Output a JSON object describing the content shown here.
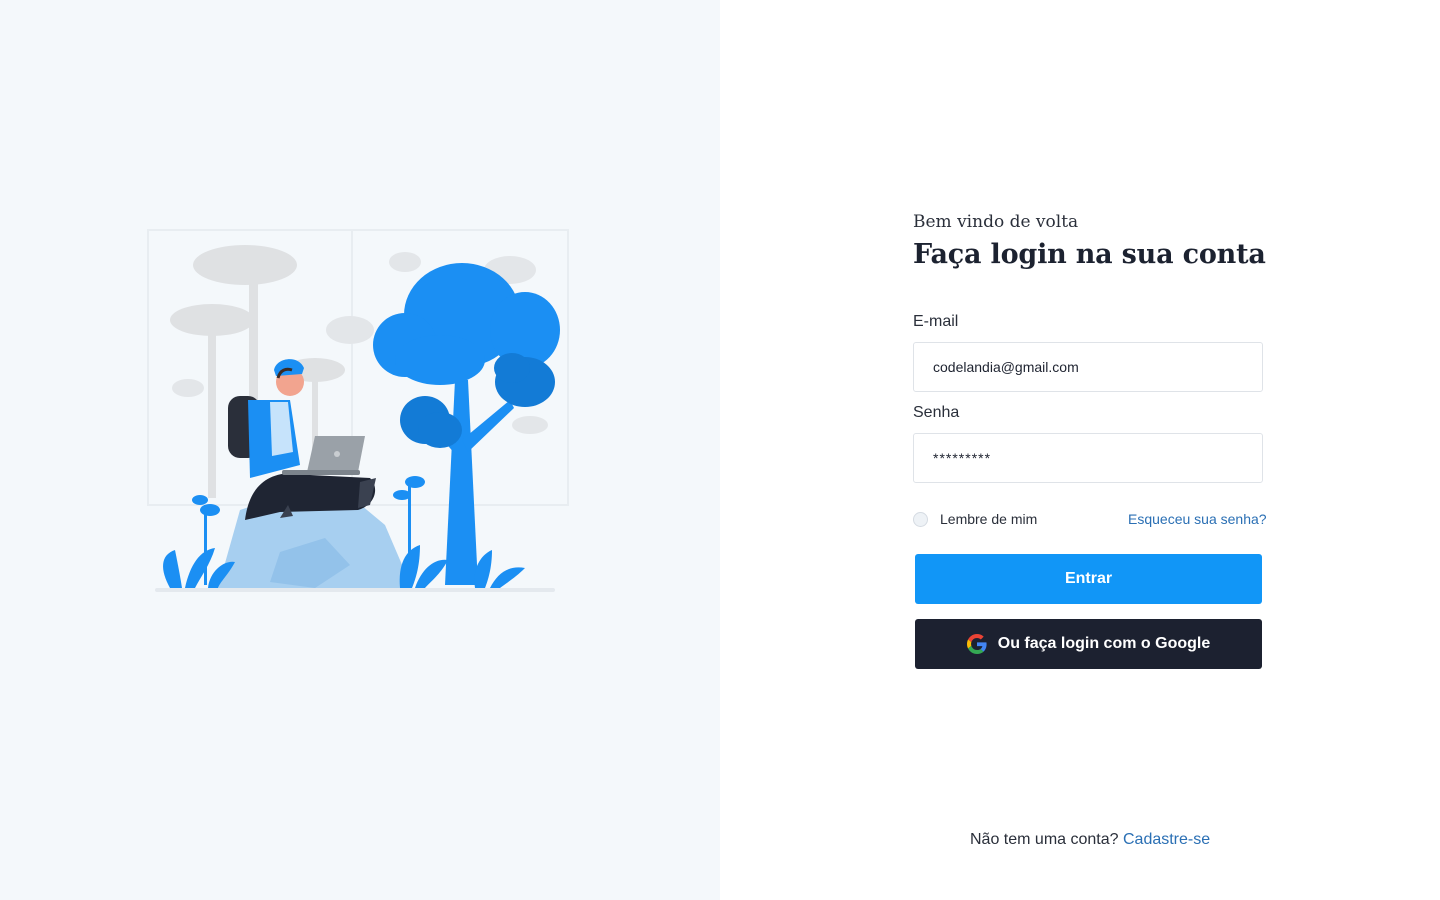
{
  "greeting": "Bem vindo de volta",
  "title": "Faça login na sua conta",
  "form": {
    "email_label": "E-mail",
    "email_value": "codelandia@gmail.com",
    "password_label": "Senha",
    "password_value": "*********",
    "remember_label": "Lembre de mim",
    "forgot_link": "Esqueceu sua senha?",
    "submit_label": "Entrar",
    "google_label": "Ou faça login com o Google"
  },
  "footer": {
    "prompt": "Não tem uma conta?",
    "signup_link": "Cadastre-se"
  },
  "colors": {
    "primary": "#1196f7",
    "dark_button": "#1c2130",
    "link": "#2a6fb4",
    "left_background": "#f4f8fb"
  },
  "icons": {
    "google": "google-logo-icon",
    "illustration": "person-with-laptop-in-forest-illustration"
  }
}
